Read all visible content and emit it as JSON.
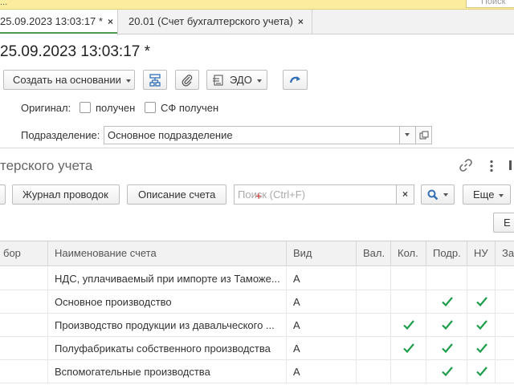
{
  "topbar": {
    "left_fragment": "...",
    "search_fragment": "Поиск"
  },
  "tabs": [
    {
      "label": "25.09.2023 13:03:17 *",
      "close": "×"
    },
    {
      "label": "20.01 (Счет бухгалтерского учета)",
      "close": "×"
    }
  ],
  "document": {
    "title": "25.09.2023 13:03:17 *",
    "toolbar": {
      "create_based_on": "Создать на основании",
      "edo": "ЭДО"
    },
    "original_label": "Оригинал:",
    "received_label": "получен",
    "sf_received_label": "СФ получен",
    "division_label": "Подразделение:",
    "division_value": "Основное подразделение"
  },
  "subform": {
    "title": "терского учета",
    "toolbar": {
      "journal": "Журнал проводок",
      "description": "Описание счета",
      "search_placeholder": "Поиск (Ctrl+F)",
      "clear": "×",
      "more": "Еще",
      "extra_button": "Е"
    }
  },
  "table": {
    "columns": [
      "бор",
      "Наименование счета",
      "Вид",
      "Вал.",
      "Кол.",
      "Подр.",
      "НУ",
      "За"
    ],
    "rows": [
      {
        "name": "НДС, уплачиваемый при импорте из Таможе...",
        "kind": "А",
        "val": false,
        "qty": false,
        "div": false,
        "nu": false
      },
      {
        "name": "Основное производство",
        "kind": "А",
        "val": false,
        "qty": false,
        "div": true,
        "nu": true
      },
      {
        "name": "Производство продукции из давальческого ...",
        "kind": "А",
        "val": false,
        "qty": true,
        "div": true,
        "nu": true
      },
      {
        "name": "Полуфабрикаты собственного производства",
        "kind": "А",
        "val": false,
        "qty": true,
        "div": true,
        "nu": true
      },
      {
        "name": "Вспомогательные производства",
        "kind": "А",
        "val": false,
        "qty": false,
        "div": true,
        "nu": true
      }
    ]
  },
  "colors": {
    "accent_green": "#4b9a52",
    "check_green": "#1e9e4a",
    "top_yellow": "#fbed9e",
    "search_blue": "#2f6fb7"
  }
}
